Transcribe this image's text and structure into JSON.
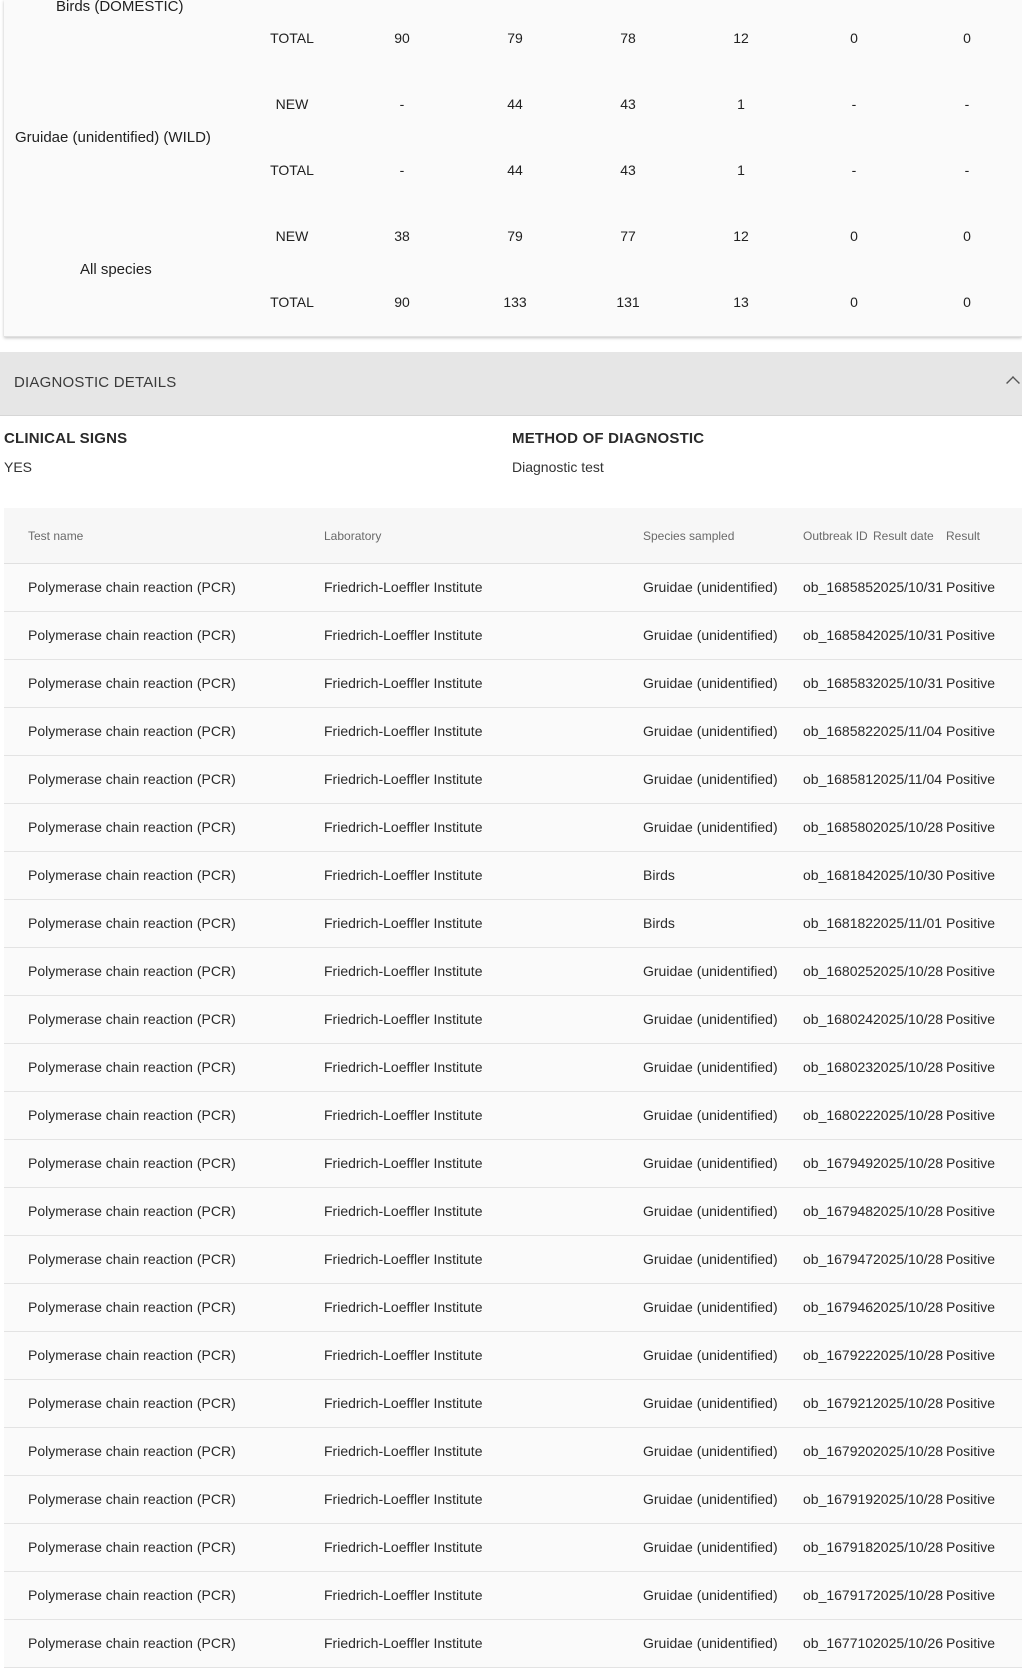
{
  "counts": {
    "groups": [
      {
        "species": "Birds (DOMESTIC)",
        "rows": [
          {
            "type": "TOTAL",
            "values": [
              "90",
              "79",
              "78",
              "12",
              "0",
              "0"
            ]
          }
        ]
      },
      {
        "species": "Gruidae (unidentified) (WILD)",
        "rows": [
          {
            "type": "NEW",
            "values": [
              "-",
              "44",
              "43",
              "1",
              "-",
              "-"
            ]
          },
          {
            "type": "TOTAL",
            "values": [
              "-",
              "44",
              "43",
              "1",
              "-",
              "-"
            ]
          }
        ]
      },
      {
        "species": "All species",
        "rows": [
          {
            "type": "NEW",
            "values": [
              "38",
              "79",
              "77",
              "12",
              "0",
              "0"
            ]
          },
          {
            "type": "TOTAL",
            "values": [
              "90",
              "133",
              "131",
              "13",
              "0",
              "0"
            ]
          }
        ]
      }
    ]
  },
  "diagnostic": {
    "section_title": "DIAGNOSTIC DETAILS",
    "clinical_signs_label": "CLINICAL SIGNS",
    "clinical_signs_value": "YES",
    "method_label": "METHOD OF DIAGNOSTIC",
    "method_value": "Diagnostic test",
    "table": {
      "headers": [
        "Test name",
        "Laboratory",
        "Species sampled",
        "Outbreak ID",
        "Result date",
        "Result"
      ],
      "rows": [
        [
          "Polymerase chain reaction (PCR)",
          "Friedrich-Loeffler Institute",
          "Gruidae (unidentified)",
          "ob_168585",
          "2025/10/31",
          "Positive"
        ],
        [
          "Polymerase chain reaction (PCR)",
          "Friedrich-Loeffler Institute",
          "Gruidae (unidentified)",
          "ob_168584",
          "2025/10/31",
          "Positive"
        ],
        [
          "Polymerase chain reaction (PCR)",
          "Friedrich-Loeffler Institute",
          "Gruidae (unidentified)",
          "ob_168583",
          "2025/10/31",
          "Positive"
        ],
        [
          "Polymerase chain reaction (PCR)",
          "Friedrich-Loeffler Institute",
          "Gruidae (unidentified)",
          "ob_168582",
          "2025/11/04",
          "Positive"
        ],
        [
          "Polymerase chain reaction (PCR)",
          "Friedrich-Loeffler Institute",
          "Gruidae (unidentified)",
          "ob_168581",
          "2025/11/04",
          "Positive"
        ],
        [
          "Polymerase chain reaction (PCR)",
          "Friedrich-Loeffler Institute",
          "Gruidae (unidentified)",
          "ob_168580",
          "2025/10/28",
          "Positive"
        ],
        [
          "Polymerase chain reaction (PCR)",
          "Friedrich-Loeffler Institute",
          "Birds",
          "ob_168184",
          "2025/10/30",
          "Positive"
        ],
        [
          "Polymerase chain reaction (PCR)",
          "Friedrich-Loeffler Institute",
          "Birds",
          "ob_168182",
          "2025/11/01",
          "Positive"
        ],
        [
          "Polymerase chain reaction (PCR)",
          "Friedrich-Loeffler Institute",
          "Gruidae (unidentified)",
          "ob_168025",
          "2025/10/28",
          "Positive"
        ],
        [
          "Polymerase chain reaction (PCR)",
          "Friedrich-Loeffler Institute",
          "Gruidae (unidentified)",
          "ob_168024",
          "2025/10/28",
          "Positive"
        ],
        [
          "Polymerase chain reaction (PCR)",
          "Friedrich-Loeffler Institute",
          "Gruidae (unidentified)",
          "ob_168023",
          "2025/10/28",
          "Positive"
        ],
        [
          "Polymerase chain reaction (PCR)",
          "Friedrich-Loeffler Institute",
          "Gruidae (unidentified)",
          "ob_168022",
          "2025/10/28",
          "Positive"
        ],
        [
          "Polymerase chain reaction (PCR)",
          "Friedrich-Loeffler Institute",
          "Gruidae (unidentified)",
          "ob_167949",
          "2025/10/28",
          "Positive"
        ],
        [
          "Polymerase chain reaction (PCR)",
          "Friedrich-Loeffler Institute",
          "Gruidae (unidentified)",
          "ob_167948",
          "2025/10/28",
          "Positive"
        ],
        [
          "Polymerase chain reaction (PCR)",
          "Friedrich-Loeffler Institute",
          "Gruidae (unidentified)",
          "ob_167947",
          "2025/10/28",
          "Positive"
        ],
        [
          "Polymerase chain reaction (PCR)",
          "Friedrich-Loeffler Institute",
          "Gruidae (unidentified)",
          "ob_167946",
          "2025/10/28",
          "Positive"
        ],
        [
          "Polymerase chain reaction (PCR)",
          "Friedrich-Loeffler Institute",
          "Gruidae (unidentified)",
          "ob_167922",
          "2025/10/28",
          "Positive"
        ],
        [
          "Polymerase chain reaction (PCR)",
          "Friedrich-Loeffler Institute",
          "Gruidae (unidentified)",
          "ob_167921",
          "2025/10/28",
          "Positive"
        ],
        [
          "Polymerase chain reaction (PCR)",
          "Friedrich-Loeffler Institute",
          "Gruidae (unidentified)",
          "ob_167920",
          "2025/10/28",
          "Positive"
        ],
        [
          "Polymerase chain reaction (PCR)",
          "Friedrich-Loeffler Institute",
          "Gruidae (unidentified)",
          "ob_167919",
          "2025/10/28",
          "Positive"
        ],
        [
          "Polymerase chain reaction (PCR)",
          "Friedrich-Loeffler Institute",
          "Gruidae (unidentified)",
          "ob_167918",
          "2025/10/28",
          "Positive"
        ],
        [
          "Polymerase chain reaction (PCR)",
          "Friedrich-Loeffler Institute",
          "Gruidae (unidentified)",
          "ob_167917",
          "2025/10/28",
          "Positive"
        ],
        [
          "Polymerase chain reaction (PCR)",
          "Friedrich-Loeffler Institute",
          "Gruidae (unidentified)",
          "ob_167710",
          "2025/10/26",
          "Positive"
        ]
      ]
    }
  }
}
